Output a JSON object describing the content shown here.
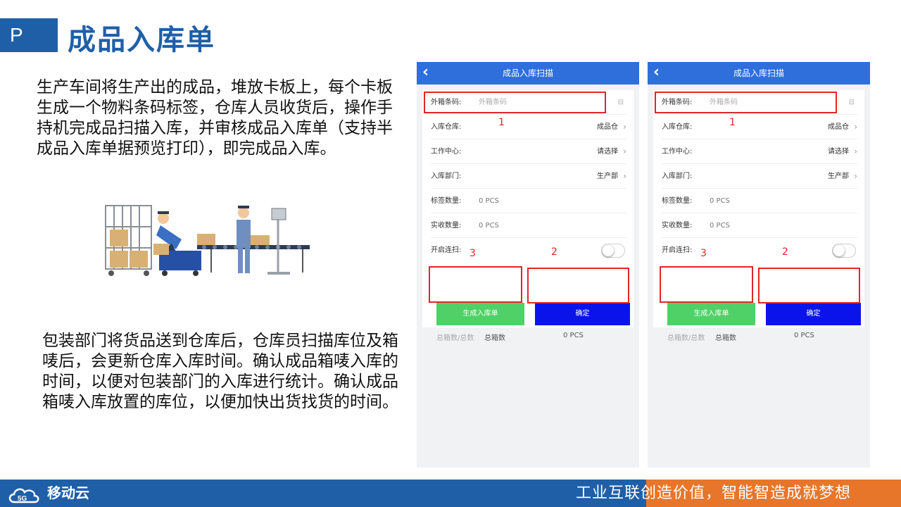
{
  "header": {
    "badge": "P",
    "title": "成品入库单"
  },
  "paragraphs": {
    "p1": "生产车间将生产出的成品，堆放卡板上，每个卡板生成一个物料条码标签，仓库人员收货后，操作手持机完成品扫描入库，并审核成品入库单（支持半成品入库单据预览打印），即完成品入库。",
    "p2": "包装部门将货品送到仓库后，仓库员扫描库位及箱唛后，会更新仓库入库时间。确认成品箱唛入库的时间，以便对包装部门的入库进行统计。确认成品箱唛入库放置的库位，以便加快出货找货的时间。"
  },
  "phone": {
    "title": "成品入库扫描",
    "back_icon": "‹",
    "barcode_label": "外箱条码:",
    "barcode_placeholder": "外箱条码",
    "warehouse_label": "入库仓库:",
    "warehouse_value": "成品仓",
    "workcenter_label": "工作中心:",
    "workcenter_value": "请选择",
    "dept_label": "入库部门:",
    "dept_value": "生产部",
    "label_qty_label": "标签数量:",
    "label_qty_value": "0 PCS",
    "actual_qty_label": "实收数量:",
    "actual_qty_value": "0 PCS",
    "continuous_label": "开启连扫:",
    "generate_button": "生成入库单",
    "confirm_button": "确定",
    "sum_boxes_label": "总箱数/总数",
    "sum_total_label": "总箱数",
    "sum_value": "0 PCS",
    "chevron": "›",
    "scan_icon": "⊟"
  },
  "markers": {
    "m1": "1",
    "m2": "2",
    "m3": "3"
  },
  "footer": {
    "logo": "移动云",
    "slogan": "工业互联创造价值，智能智造成就梦想"
  },
  "colors": {
    "brand_blue": "#1f5fa8",
    "app_blue": "#2f6fdc",
    "green": "#4fd167",
    "confirm_blue": "#0a14ea",
    "red": "#e0262b",
    "orange": "#e7762a"
  }
}
